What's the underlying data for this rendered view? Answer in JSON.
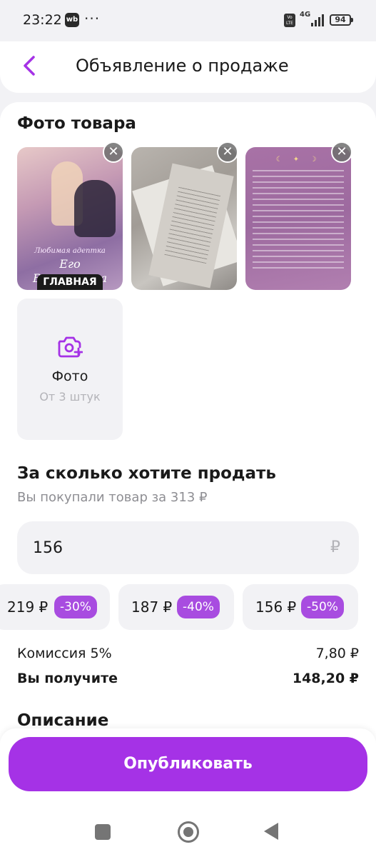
{
  "status_bar": {
    "time": "23:22",
    "app_badge": "wb",
    "dots": "···",
    "volte": "Vo LTE",
    "network": "4G",
    "battery": "94"
  },
  "header": {
    "title": "Объявление о продаже"
  },
  "photos_section": {
    "title": "Фото товара",
    "main_badge": "ГЛАВНАЯ",
    "book_subtitle": "Любимая адептка",
    "book_title": "Его Величества",
    "add_photo_label": "Фото",
    "add_photo_hint": "От 3 штук"
  },
  "price_section": {
    "title": "За сколько хотите продать",
    "subtitle": "Вы покупали товар за 313 ₽",
    "input_value": "156",
    "currency": "₽",
    "suggestions": [
      {
        "price": "219 ₽",
        "discount": "-30%"
      },
      {
        "price": "187 ₽",
        "discount": "-40%"
      },
      {
        "price": "156 ₽",
        "discount": "-50%"
      }
    ],
    "commission_label": "Комиссия 5%",
    "commission_value": "7,80 ₽",
    "receive_label": "Вы получите",
    "receive_value": "148,20 ₽"
  },
  "description_section": {
    "title": "Описание"
  },
  "actions": {
    "publish_label": "Опубликовать"
  },
  "colors": {
    "accent": "#a532e6",
    "discount_badge": "#a84ce0",
    "background": "#f2f2f5"
  },
  "icons": {
    "back": "chevron-left-icon",
    "remove": "close-icon",
    "camera": "camera-plus-icon"
  }
}
